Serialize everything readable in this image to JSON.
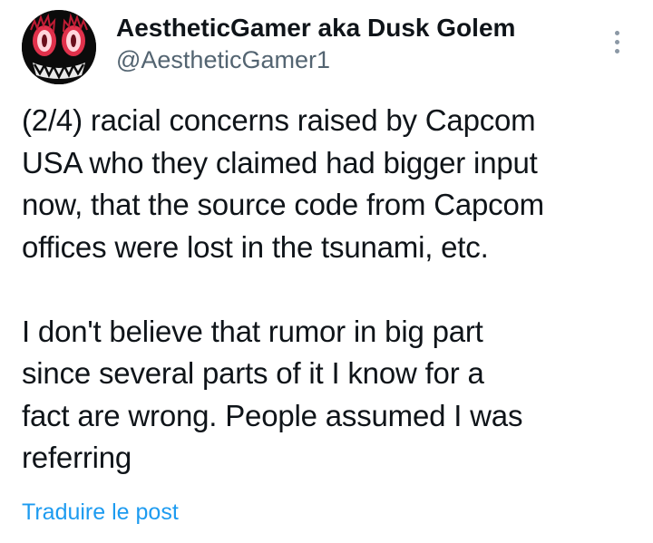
{
  "author": {
    "display_name": "AestheticGamer aka Dusk Golem",
    "handle": "@AestheticGamer1",
    "avatar_icon": "demon-face-avatar"
  },
  "menu": {
    "icon": "more-vertical-icon"
  },
  "post": {
    "paragraph_1": "(2/4) racial concerns raised by Capcom\nUSA who they claimed had bigger input\nnow, that the source code from Capcom\noffices were lost in the tsunami, etc.",
    "paragraph_2": "I don't believe that rumor in big part\nsince several parts of it I know for a\nfact are wrong. People assumed I was\nreferring"
  },
  "translate": {
    "label": "Traduire le post"
  },
  "colors": {
    "text": "#0f1419",
    "secondary": "#536471",
    "link": "#1d9bf0",
    "avatar_bg": "#0b0b0b",
    "avatar_accent": "#e0314b"
  }
}
